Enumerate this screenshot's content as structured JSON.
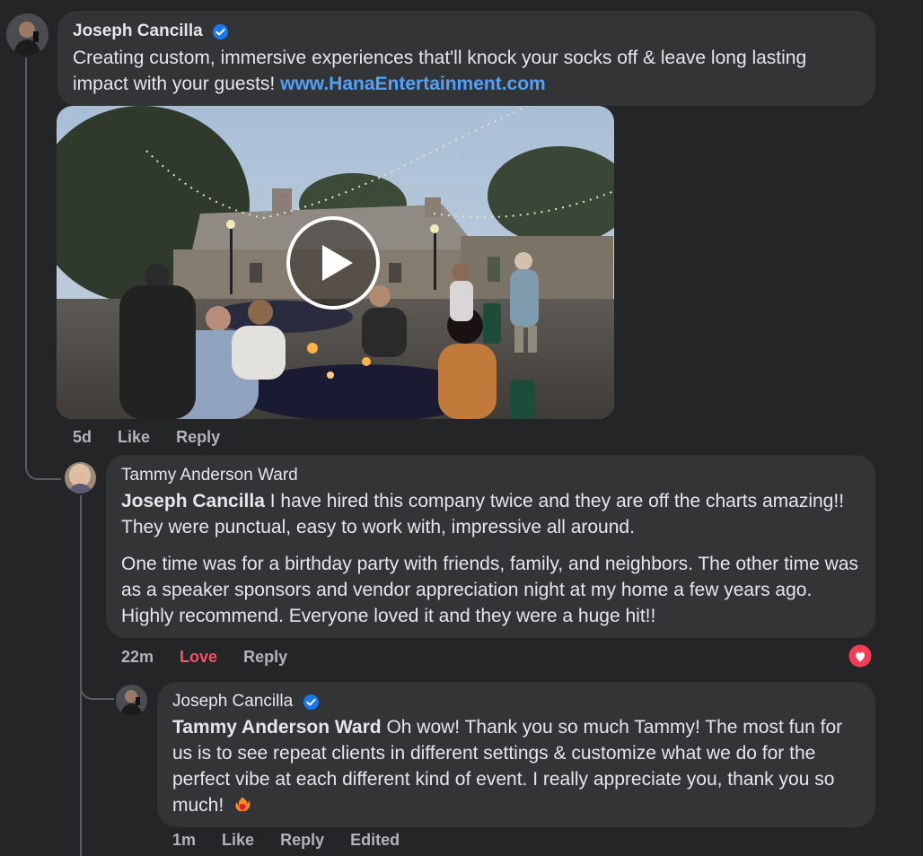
{
  "comment1": {
    "author": "Joseph Cancilla",
    "text": "Creating custom, immersive experiences that'll knock your socks off & leave long lasting impact with your guests!",
    "link": "www.HanaEntertainment.com",
    "time": "5d",
    "like": "Like",
    "reply": "Reply"
  },
  "comment2": {
    "author": "Tammy Anderson Ward",
    "mention": "Joseph Cancilla",
    "text_p1": "I have hired this company twice and they are off the charts amazing!! They were punctual, easy to work with, impressive all around.",
    "text_p2": "One time was for a birthday party with friends, family, and neighbors. The other time was as a speaker sponsors and vendor appreciation night at my home a few years ago. Highly recommend. Everyone loved it and they were a huge hit!!",
    "time": "22m",
    "love": "Love",
    "reply": "Reply"
  },
  "comment3": {
    "author": "Joseph Cancilla",
    "mention": "Tammy Anderson Ward",
    "text": "Oh wow! Thank you so much Tammy! The most fun for us is to see repeat clients in different settings & customize what we do for the perfect vibe at each different kind of event. I really appreciate you, thank you so much!",
    "time": "1m",
    "like": "Like",
    "reply": "Reply",
    "edited": "Edited"
  },
  "colors": {
    "background": "#242526",
    "bubble": "#333436",
    "link": "#4ea1ff",
    "love": "#f25268",
    "verified": "#1877f2"
  }
}
